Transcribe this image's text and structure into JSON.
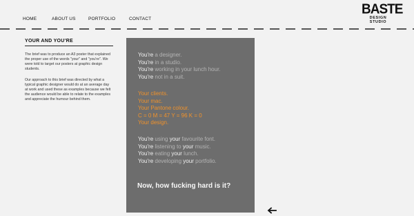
{
  "nav": {
    "items": [
      {
        "label": "HOME"
      },
      {
        "label": "ABOUT US"
      },
      {
        "label": "PORTFOLIO"
      },
      {
        "label": "CONTACT"
      }
    ]
  },
  "logo": {
    "main": "BASTE",
    "sub": "DESIGN STUDIO"
  },
  "page": {
    "title": "YOUR AND YOU'RE",
    "para1": "The brief was to produce an A3 poster that explained the proper use of the words \"your\" and \"you're\". We were told to target our posters at graphic design students.",
    "para2": "Our approach to this brief was directed by what a typical graphic designer would do at an average day at work and used these as examples because we felt the audience would be able to relate to the examples and appreciate the humour behind them."
  },
  "poster": {
    "group1": [
      {
        "a": "You're",
        "b": " a designer."
      },
      {
        "a": "You're",
        "b": " in a studio."
      },
      {
        "a": "You're",
        "b": " working in your lunch hour."
      },
      {
        "a": "You're",
        "b": " not in a suit."
      }
    ],
    "group2": [
      {
        "a": "Your",
        "b": " clients."
      },
      {
        "a": "Your",
        "b": " mac."
      },
      {
        "a": "Your",
        "b": " Pantone colour."
      },
      {
        "a": "",
        "b": "C = 0 M = 47 Y = 96 K = 0"
      },
      {
        "a": "Your",
        "b": " design."
      }
    ],
    "group3": [
      {
        "a": "You're",
        "b": " using ",
        "c": "your",
        "d": " favourite font."
      },
      {
        "a": "You're",
        "b": " listening to ",
        "c": "your",
        "d": " music."
      },
      {
        "a": "You're",
        "b": " eating ",
        "c": "your",
        "d": " lunch."
      },
      {
        "a": "You're",
        "b": " developing ",
        "c": "your",
        "d": " portfolio."
      }
    ],
    "ending": "Now, how fucking hard is it?"
  },
  "colors": {
    "accent": "#f0922b",
    "poster_bg": "#6d6d6d",
    "page_bg": "#f2f2f2"
  },
  "icons": {
    "back": "left-arrow-icon"
  }
}
